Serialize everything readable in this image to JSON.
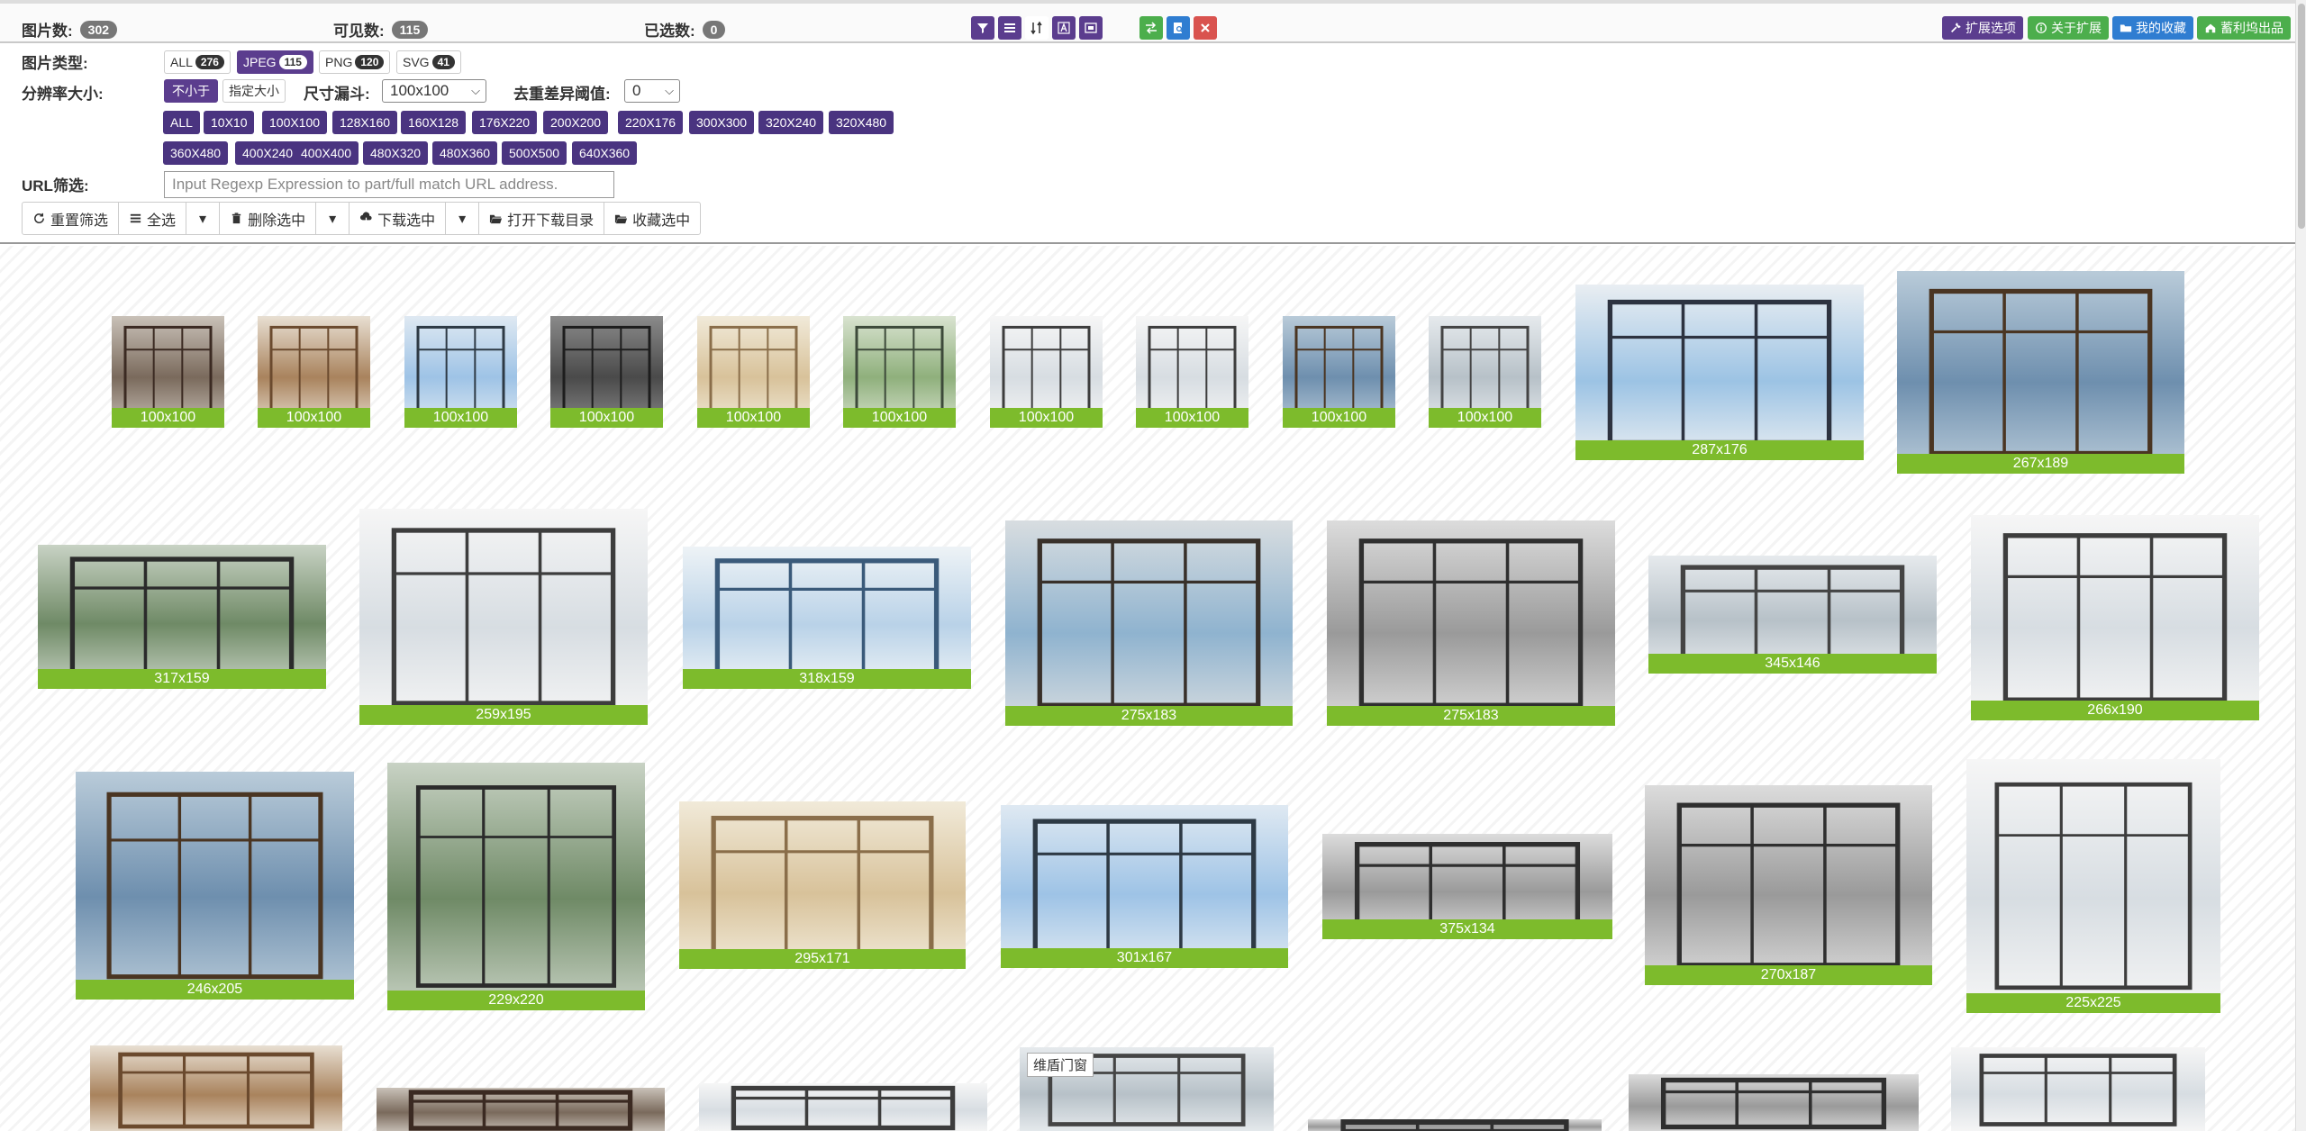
{
  "stats": {
    "total_label": "图片数:",
    "total": "302",
    "visible_label": "可见数:",
    "visible": "115",
    "selected_label": "已选数:",
    "selected": "0"
  },
  "toolbar_icons": [
    "filter-icon",
    "list-icon",
    "sort-icon",
    "font-icon",
    "layout-icon",
    "swap-icon",
    "search-doc-icon",
    "close-icon"
  ],
  "right_buttons": {
    "extension": "扩展选项",
    "about": "关于扩展",
    "favorites": "我的收藏",
    "brand": "蓄利坞出品"
  },
  "filters": {
    "type_label": "图片类型:",
    "types": [
      {
        "label": "ALL",
        "count": "276",
        "selected": false
      },
      {
        "label": "JPEG",
        "count": "115",
        "selected": true
      },
      {
        "label": "PNG",
        "count": "120",
        "selected": false
      },
      {
        "label": "SVG",
        "count": "41",
        "selected": false
      }
    ],
    "size_label": "分辨率大小:",
    "min_mode": "不小于",
    "exact_mode": "指定大小",
    "funnel_label": "尺寸漏斗:",
    "funnel_value": "100x100",
    "dedup_label": "去重差异阈值:",
    "dedup_value": "0",
    "resolutions_row1": [
      "ALL",
      "10X10",
      "100X100",
      "128X160",
      "160X128",
      "176X220",
      "200X200",
      "220X176",
      "300X300",
      "320X240",
      "320X480"
    ],
    "resolutions_row2": [
      "360X480",
      "400X240",
      "400X400",
      "480X320",
      "480X360",
      "500X500",
      "640X360"
    ],
    "url_label": "URL筛选:",
    "url_placeholder": "Input Regexp Expression to part/full match URL address."
  },
  "actions": {
    "reset": "重置筛选",
    "select_all": "全选",
    "delete": "删除选中",
    "download": "下载选中",
    "open_dir": "打开下载目录",
    "favorite": "收藏选中"
  },
  "gallery": [
    {
      "size": "100x100",
      "theme": "brown"
    },
    {
      "size": "100x100",
      "theme": "wood"
    },
    {
      "size": "100x100",
      "theme": "sky"
    },
    {
      "size": "100x100",
      "theme": "dark"
    },
    {
      "size": "100x100",
      "theme": "cream"
    },
    {
      "size": "100x100",
      "theme": "green"
    },
    {
      "size": "100x100",
      "theme": "white"
    },
    {
      "size": "100x100",
      "theme": "white"
    },
    {
      "size": "100x100",
      "theme": "sea"
    },
    {
      "size": "100x100",
      "theme": "mist"
    },
    {
      "size": "287x176",
      "theme": "pool"
    },
    {
      "size": "267x189",
      "theme": "sea"
    },
    {
      "size": "317x159",
      "theme": "forest"
    },
    {
      "size": "259x195",
      "theme": "white"
    },
    {
      "size": "318x159",
      "theme": "house"
    },
    {
      "size": "275x183",
      "theme": "city"
    },
    {
      "size": "275x183",
      "theme": "grey"
    },
    {
      "size": "345x146",
      "theme": "mist"
    },
    {
      "size": "266x190",
      "theme": "white"
    },
    {
      "size": "246x205",
      "theme": "sea"
    },
    {
      "size": "229x220",
      "theme": "forest"
    },
    {
      "size": "295x171",
      "theme": "cream"
    },
    {
      "size": "301x167",
      "theme": "sky"
    },
    {
      "size": "375x134",
      "theme": "grey"
    },
    {
      "size": "270x187",
      "theme": "grey"
    },
    {
      "size": "225x225",
      "theme": "white"
    },
    {
      "size": "",
      "theme": "wood"
    },
    {
      "size": "",
      "theme": "brown"
    },
    {
      "size": "",
      "theme": "white"
    },
    {
      "size": "",
      "theme": "mist",
      "badge": "维盾门窗"
    },
    {
      "size": "",
      "theme": "grey"
    },
    {
      "size": "",
      "theme": "grey"
    },
    {
      "size": "",
      "theme": "white"
    }
  ]
}
